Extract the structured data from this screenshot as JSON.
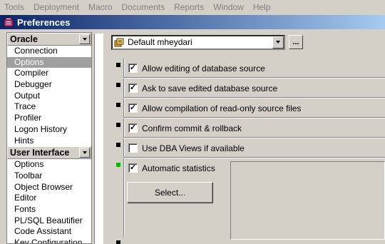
{
  "menu": [
    "Tools",
    "Deployment",
    "Macro",
    "Documents",
    "Reports",
    "Window",
    "Help"
  ],
  "window": {
    "title": "Preferences"
  },
  "sidebar": {
    "groups": [
      {
        "title": "Oracle",
        "items": [
          "Connection",
          "Options",
          "Compiler",
          "Debugger",
          "Output",
          "Trace",
          "Profiler",
          "Logon History",
          "Hints"
        ]
      },
      {
        "title": "User Interface",
        "items": [
          "Options",
          "Toolbar",
          "Object Browser",
          "Editor",
          "Fonts",
          "PL/SQL Beautifier",
          "Code Assistant",
          "Key Configuration"
        ]
      }
    ],
    "selected": "Options"
  },
  "user_combo": {
    "value": "Default mheydari",
    "more_label": "..."
  },
  "options": [
    {
      "label": "Allow editing of database source",
      "checked": true
    },
    {
      "label": "Ask to save edited database source",
      "checked": true
    },
    {
      "label": "Allow compilation of read-only source files",
      "checked": true
    },
    {
      "label": "Confirm commit & rollback",
      "checked": true
    },
    {
      "label": "Use DBA Views if available",
      "checked": false
    }
  ],
  "auto_stats": {
    "label": "Automatic statistics",
    "checked": true,
    "select_label": "Select..."
  },
  "colors": {
    "title_start": "#0a246a",
    "title_end": "#a6caf0",
    "changed_marker": "#00c000",
    "default_marker": "#000000"
  }
}
